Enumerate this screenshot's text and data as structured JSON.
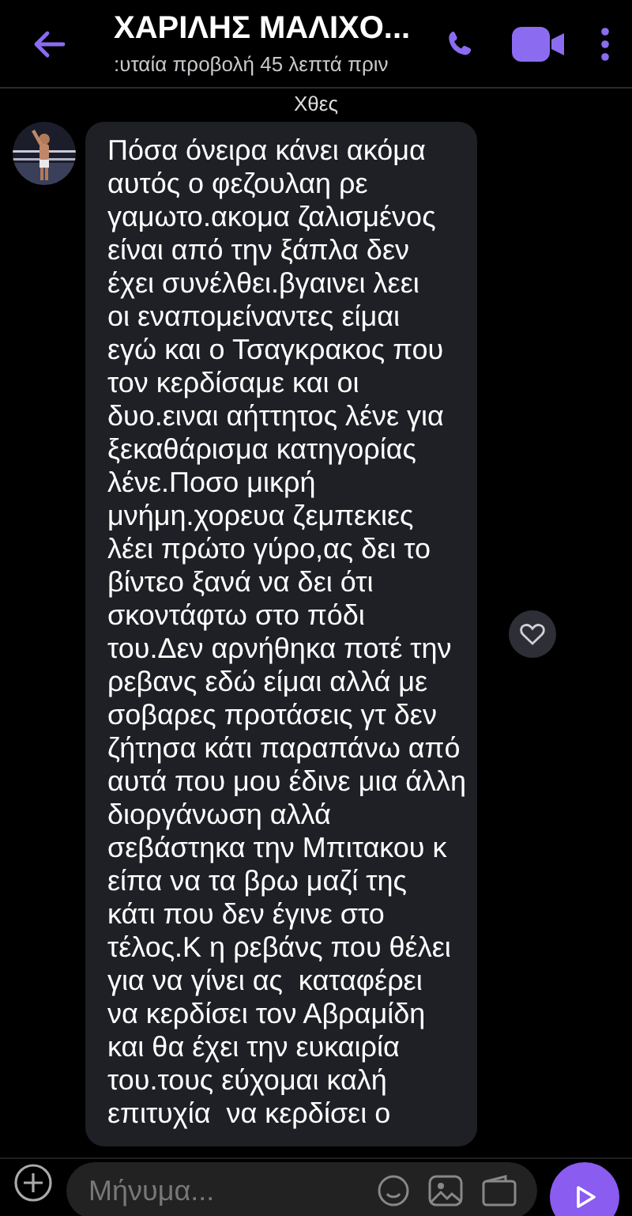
{
  "header": {
    "title": "ΧΑΡΙΛΗΣ ΜΑΛΙΧΟ...",
    "subtitle": ":υταία προβολή 45 λεπτά πριν"
  },
  "date_separator": "Χθες",
  "message": {
    "liked": false,
    "lines": [
      "Πόσα όνειρα κάνει ακόμα",
      "αυτός ο φεζουλαη ρε",
      "γαμωτο.ακομα ζαλισμένος",
      "είναι από την ξάπλα δεν",
      "έχει συνέλθει.βγαινει λεει",
      "οι εναπομείναντες είμαι",
      "εγώ και ο Τσαγκρακος που",
      "τον κερδίσαμε και οι",
      "δυο.ειναι αήττητος λένε για",
      "ξεκαθάρισμα κατηγορίας",
      "λένε.Ποσο μικρή",
      "μνήμη.χορευα ζεμπεκιες",
      "λέει πρώτο γύρο,ας δει το",
      "βίντεο ξανά να δει ότι",
      "σκοντάφτω στο πόδι",
      "του.Δεν αρνήθηκα ποτέ την",
      "ρεβανς εδώ είμαι αλλά με",
      "σοβαρες προτάσεις γτ δεν",
      "ζήτησα κάτι παραπάνω από",
      "αυτά που μου έδινε μια άλλη",
      "διοργάνωση αλλά",
      "σεβάστηκα την Μπιτακου κ",
      "είπα να τα βρω μαζί της",
      "κάτι που δεν έγινε στο",
      "τέλος.Κ η ρεβάνς που θέλει",
      "για να γίνει ας  καταφέρει",
      "να κερδίσει τον Αβραμίδη",
      "και θα έχει την ευκαιρία",
      "του.τους εύχομαι καλή",
      "επιτυχία  να κερδίσει ο"
    ]
  },
  "composer": {
    "placeholder": "Μήνυμα..."
  }
}
